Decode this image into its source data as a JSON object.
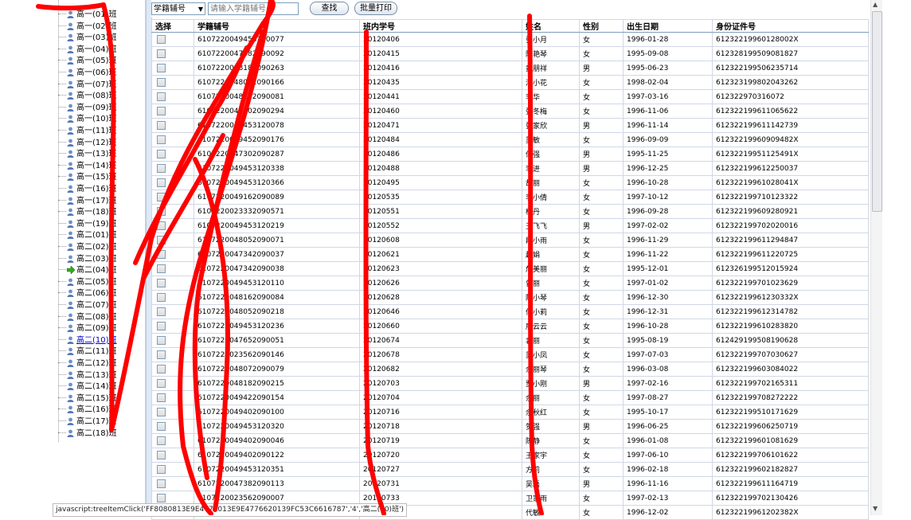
{
  "tree": {
    "items": [
      "高一(01)班",
      "高一(02)班",
      "高一(03)班",
      "高一(04)班",
      "高一(05)班",
      "高一(06)班",
      "高一(07)班",
      "高一(08)班",
      "高一(09)班",
      "高一(10)班",
      "高一(11)班",
      "高一(12)班",
      "高一(13)班",
      "高一(14)班",
      "高一(15)班",
      "高一(16)班",
      "高一(17)班",
      "高一(18)班",
      "高一(19)班",
      "高二(01)班",
      "高二(02)班",
      "高二(03)班",
      "高二(04)班",
      "高二(05)班",
      "高二(06)班",
      "高二(07)班",
      "高二(08)班",
      "高二(09)班",
      "高二(10)班",
      "高二(11)班",
      "高二(12)班",
      "高二(13)班",
      "高二(14)班",
      "高二(15)班",
      "高二(16)班",
      "高二(17)班",
      "高二(18)班"
    ],
    "selected_index": 22,
    "current_index": 28
  },
  "toolbar": {
    "field_select": "学籍辅号",
    "search_placeholder": "请输入学籍辅号",
    "search_button": "查找",
    "print_button": "批量打印"
  },
  "table": {
    "headers": [
      "选择",
      "学籍辅号",
      "班内学号",
      "姓名",
      "性别",
      "出生日期",
      "身份证件号"
    ],
    "rows": [
      [
        "6107220049453120077",
        "20120406",
        "张小月",
        "女",
        "1996-01-28",
        "61232219960128002X"
      ],
      [
        "6107220047382090092",
        "20120415",
        "陈艳琴",
        "女",
        "1995-09-08",
        "612328199509081827"
      ],
      [
        "6107220048182090263",
        "20120416",
        "黄朋祥",
        "男",
        "1995-06-23",
        "612322199506235714"
      ],
      [
        "6107220048072090166",
        "20120435",
        "潘小花",
        "女",
        "1998-02-04",
        "612323199802043262"
      ],
      [
        "6107220048182090081",
        "20120441",
        "李华",
        "女",
        "1997-03-16",
        "612322970316072"
      ],
      [
        "6107220049402090294",
        "20120460",
        "张冬梅",
        "女",
        "1996-11-06",
        "612322199611065622"
      ],
      [
        "6107220049453120078",
        "20120471",
        "张家欣",
        "男",
        "1996-11-14",
        "612322199611142739"
      ],
      [
        "6107220049452090176",
        "20120484",
        "吴敏",
        "女",
        "1996-09-09",
        "61232219960909482X"
      ],
      [
        "6107220047302090287",
        "20120486",
        "何强",
        "男",
        "1995-11-25",
        "61232219951125491X"
      ],
      [
        "6107220049453120338",
        "20120488",
        "李进",
        "男",
        "1996-12-25",
        "612322199612250037"
      ],
      [
        "6107220049453120366",
        "20120495",
        "胡丽",
        "女",
        "1996-10-28",
        "61232219961028041X"
      ],
      [
        "6107220049162090089",
        "20120535",
        "李小倩",
        "女",
        "1997-10-12",
        "612322199710123322"
      ],
      [
        "6107220023332090571",
        "20120551",
        "杨丹",
        "女",
        "1996-09-28",
        "612322199609280921"
      ],
      [
        "6107220049453120219",
        "20120552",
        "王飞飞",
        "男",
        "1997-02-02",
        "612322199702020016"
      ],
      [
        "6107220048052090071",
        "20120608",
        "段小雨",
        "女",
        "1996-11-29",
        "612322199611294847"
      ],
      [
        "6107220047342090037",
        "20120621",
        "赵娟",
        "女",
        "1996-11-22",
        "612322199611220725"
      ],
      [
        "6107220047342090038",
        "20120623",
        "危美丽",
        "女",
        "1995-12-01",
        "612326199512015924"
      ],
      [
        "6107220049453120110",
        "20120626",
        "曾丽",
        "女",
        "1997-01-02",
        "612322199701023629"
      ],
      [
        "6107220048162090084",
        "20120628",
        "陈小琴",
        "女",
        "1996-12-30",
        "61232219961230332X"
      ],
      [
        "6107220048052090218",
        "20120646",
        "何小莉",
        "女",
        "1996-12-31",
        "612322199612314782"
      ],
      [
        "6107220049453120236",
        "20120660",
        "廖云云",
        "女",
        "1996-10-28",
        "612322199610283820"
      ],
      [
        "6107220047652090051",
        "20120674",
        "袁丽",
        "女",
        "1995-08-19",
        "612429199508190628"
      ],
      [
        "6107220023562090146",
        "20120678",
        "吴小凤",
        "女",
        "1997-07-03",
        "612322199707030627"
      ],
      [
        "6107220048072090079",
        "20120682",
        "余丽琴",
        "女",
        "1996-03-08",
        "612322199603084022"
      ],
      [
        "6107220048182090215",
        "20120703",
        "贾小刚",
        "男",
        "1997-02-16",
        "612322199702165311"
      ],
      [
        "6107220049422090154",
        "20120704",
        "余丽",
        "女",
        "1997-08-27",
        "612322199708272222"
      ],
      [
        "6107220049402090100",
        "20120716",
        "余秋红",
        "女",
        "1995-10-17",
        "612322199510171629"
      ],
      [
        "6107220049453120320",
        "20120718",
        "贺强",
        "男",
        "1996-06-25",
        "612322199606250719"
      ],
      [
        "6107220049402090046",
        "20120719",
        "陈静",
        "女",
        "1996-01-08",
        "612322199601081629"
      ],
      [
        "6107220049402090122",
        "20120720",
        "王家宇",
        "女",
        "1997-06-10",
        "612322199706101622"
      ],
      [
        "6107220049453120351",
        "20120727",
        "方莉",
        "女",
        "1996-02-18",
        "612322199602182827"
      ],
      [
        "6107220047382090113",
        "20120731",
        "吴磊",
        "男",
        "1996-11-16",
        "612322199611164719"
      ],
      [
        "6107220023562090007",
        "20120733",
        "卫家雨",
        "女",
        "1997-02-13",
        "612322199702130426"
      ],
      [
        "6107220049453120199",
        "20120735",
        "代敏",
        "女",
        "1996-12-02",
        "61232219961202382X"
      ]
    ]
  },
  "statusbar": {
    "text": "javascript:treeItemClick('FF8080813E9E4770013E9E4776620139FC53C6616787','4','高二(10)班')"
  },
  "colors": {
    "accent_blue": "#0000cc",
    "scribble_red": "#ff0000",
    "grid_line": "#d0d7e5"
  }
}
